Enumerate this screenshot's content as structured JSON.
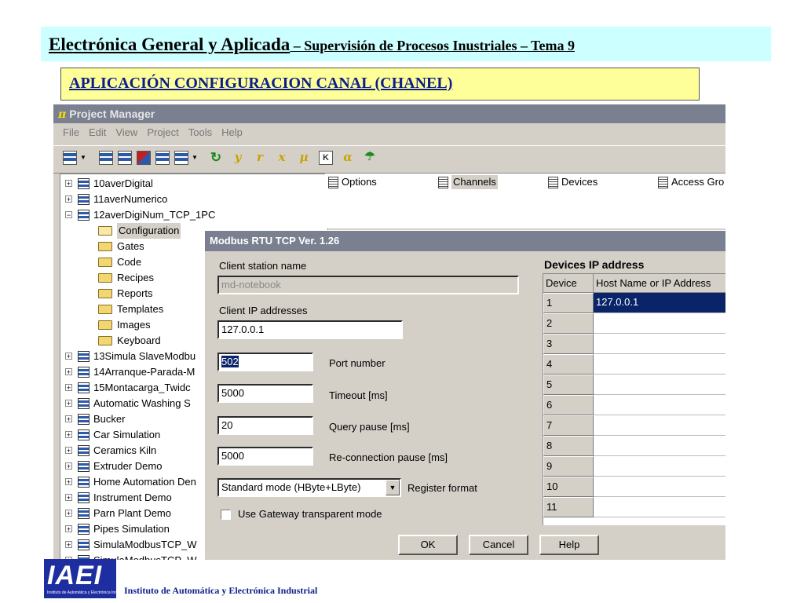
{
  "slide": {
    "header_main": "Electrónica General y Aplicada",
    "header_rest": " – Supervisión de Procesos Inustriales  –   Tema 9",
    "subtitle": "APLICACIÓN CONFIGURACION CANAL (CHANEL)",
    "footer": "Instituto de Automática y Electrónica Industrial",
    "logo_text": "IAEI",
    "logo_small": "Instituto de Automática y Electrónica Industrial"
  },
  "app": {
    "title": "Project Manager",
    "title_icon": "π",
    "menu": [
      "File",
      "Edit",
      "View",
      "Project",
      "Tools",
      "Help"
    ],
    "toolbar_icons": [
      "project-icon",
      "new-project-icon",
      "open-project-icon",
      "delete-project-icon",
      "copy-project-icon",
      "export-project-icon",
      "refresh-icon",
      "tool-a-icon",
      "tool-b-icon",
      "tool-c-icon",
      "tool-mu-icon",
      "box-icon",
      "tool-alpha-icon",
      "network-icon"
    ]
  },
  "tree": [
    {
      "label": "10averDigital",
      "type": "project",
      "expander": "+"
    },
    {
      "label": "11averNumerico",
      "type": "project",
      "expander": "+"
    },
    {
      "label": "12averDigiNum_TCP_1PC",
      "type": "project",
      "expander": "−"
    },
    {
      "label": "Configuration",
      "type": "folder-open",
      "selected": true
    },
    {
      "label": "Gates",
      "type": "folder"
    },
    {
      "label": "Code",
      "type": "folder"
    },
    {
      "label": "Recipes",
      "type": "folder"
    },
    {
      "label": "Reports",
      "type": "folder"
    },
    {
      "label": "Templates",
      "type": "folder"
    },
    {
      "label": "Images",
      "type": "folder"
    },
    {
      "label": "Keyboard",
      "type": "folder"
    },
    {
      "label": "13Simula SlaveModbu",
      "type": "project",
      "expander": "+"
    },
    {
      "label": "14Arranque-Parada-M",
      "type": "project",
      "expander": "+"
    },
    {
      "label": "15Montacarga_Twidc",
      "type": "project",
      "expander": "+"
    },
    {
      "label": "Automatic Washing S",
      "type": "project",
      "expander": "+"
    },
    {
      "label": "Bucker",
      "type": "project",
      "expander": "+"
    },
    {
      "label": "Car Simulation",
      "type": "project",
      "expander": "+"
    },
    {
      "label": "Ceramics Kiln",
      "type": "project",
      "expander": "+"
    },
    {
      "label": "Extruder Demo",
      "type": "project",
      "expander": "+"
    },
    {
      "label": "Home Automation Den",
      "type": "project",
      "expander": "+"
    },
    {
      "label": "Instrument Demo",
      "type": "project",
      "expander": "+"
    },
    {
      "label": "Parn Plant Demo",
      "type": "project",
      "expander": "+"
    },
    {
      "label": "Pipes Simulation",
      "type": "project",
      "expander": "+"
    },
    {
      "label": "SimulaModbusTCP_W",
      "type": "project",
      "expander": "+"
    },
    {
      "label": "SimulaModbusTCP_W",
      "type": "project",
      "expander": "+"
    }
  ],
  "config_items": [
    {
      "label": "Options",
      "selected": false
    },
    {
      "label": "Channels",
      "selected": true
    },
    {
      "label": "Devices",
      "selected": false
    },
    {
      "label": "Access Gro",
      "selected": false
    }
  ],
  "dialog": {
    "title": "Modbus RTU TCP  Ver. 1.26",
    "client_station_label": "Client station name",
    "client_station_value": "md-notebook",
    "client_ip_label": "Client IP addresses",
    "client_ip_value": "127.0.0.1",
    "port_value": "502",
    "port_label": "Port number",
    "timeout_value": "5000",
    "timeout_label": "Timeout [ms]",
    "query_value": "20",
    "query_label": "Query pause [ms]",
    "reconnect_value": "5000",
    "reconnect_label": "Re-connection pause [ms]",
    "register_format_value": "Standard mode (HByte+LByte)",
    "register_format_label": "Register format",
    "gateway_checked": false,
    "gateway_label": "Use Gateway transparent mode",
    "ok_label": "OK",
    "cancel_label": "Cancel",
    "help_label": "Help",
    "devices": {
      "title": "Devices IP address",
      "col_device": "Device",
      "col_host": "Host Name or IP Address",
      "rows": [
        {
          "num": "1",
          "host": "127.0.0.1",
          "selected": true
        },
        {
          "num": "2",
          "host": ""
        },
        {
          "num": "3",
          "host": ""
        },
        {
          "num": "4",
          "host": ""
        },
        {
          "num": "5",
          "host": ""
        },
        {
          "num": "6",
          "host": ""
        },
        {
          "num": "7",
          "host": ""
        },
        {
          "num": "8",
          "host": ""
        },
        {
          "num": "9",
          "host": ""
        },
        {
          "num": "10",
          "host": ""
        },
        {
          "num": "11",
          "host": ""
        }
      ]
    }
  }
}
